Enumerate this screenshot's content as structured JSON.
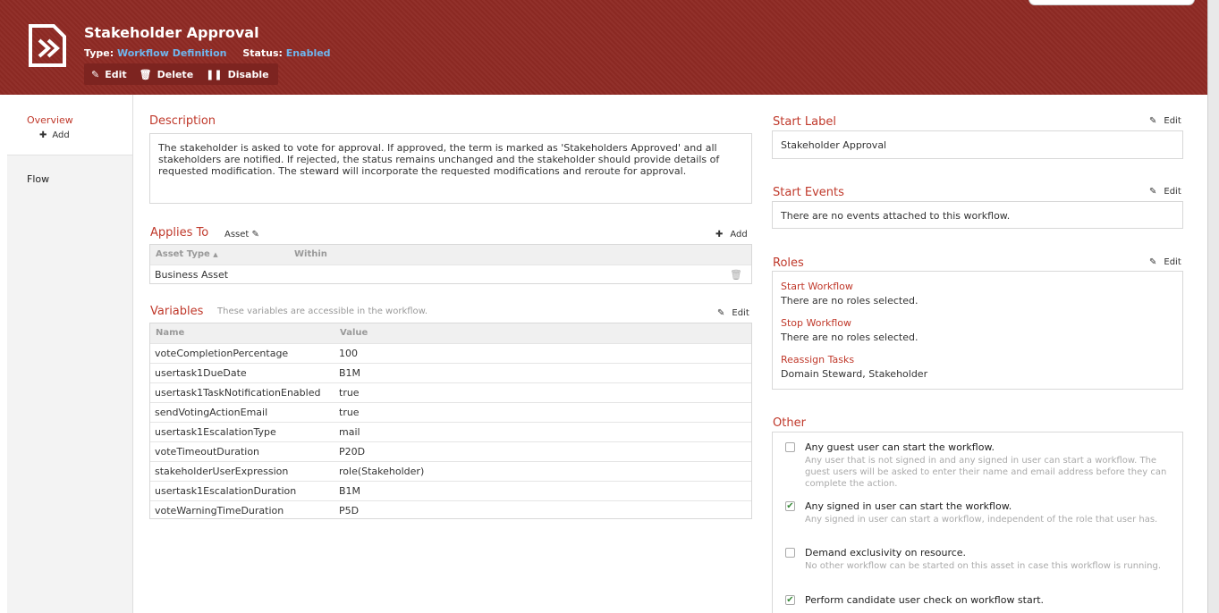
{
  "header": {
    "title": "Stakeholder Approval",
    "type_label": "Type:",
    "type_value": "Workflow Definition",
    "status_label": "Status:",
    "status_value": "Enabled",
    "actions": {
      "edit": "Edit",
      "delete": "Delete",
      "disable": "Disable"
    }
  },
  "sidebar": {
    "overview": "Overview",
    "add": "Add",
    "flow": "Flow"
  },
  "description": {
    "heading": "Description",
    "text": "The stakeholder is asked to vote for approval. If approved, the term is marked as 'Stakeholders Approved' and all stakeholders are notified. If rejected, the status remains unchanged and the stakeholder should provide details of requested modification. The steward will incorporate the requested modifications and reroute for approval."
  },
  "applies_to": {
    "heading": "Applies To",
    "asset_label": "Asset",
    "add": "Add",
    "columns": [
      "Asset Type",
      "Within"
    ],
    "rows": [
      [
        "Business Asset",
        ""
      ]
    ]
  },
  "variables": {
    "heading": "Variables",
    "hint": "These variables are accessible in the workflow.",
    "edit": "Edit",
    "columns": [
      "Name",
      "Value"
    ],
    "rows": [
      [
        "voteCompletionPercentage",
        "100"
      ],
      [
        "usertask1DueDate",
        "B1M"
      ],
      [
        "usertask1TaskNotificationEnabled",
        "true"
      ],
      [
        "sendVotingActionEmail",
        "true"
      ],
      [
        "usertask1EscalationType",
        "mail"
      ],
      [
        "voteTimeoutDuration",
        "P20D"
      ],
      [
        "stakeholderUserExpression",
        "role(Stakeholder)"
      ],
      [
        "usertask1EscalationDuration",
        "B1M"
      ],
      [
        "voteWarningTimeDuration",
        "P5D"
      ]
    ]
  },
  "start_label": {
    "heading": "Start Label",
    "edit": "Edit",
    "value": "Stakeholder Approval"
  },
  "start_events": {
    "heading": "Start Events",
    "edit": "Edit",
    "value": "There are no events attached to this workflow."
  },
  "roles": {
    "heading": "Roles",
    "edit": "Edit",
    "items": [
      {
        "title": "Start Workflow",
        "value": "There are no roles selected."
      },
      {
        "title": "Stop Workflow",
        "value": "There are no roles selected."
      },
      {
        "title": "Reassign Tasks",
        "value": "Domain Steward, Stakeholder"
      }
    ]
  },
  "other": {
    "heading": "Other",
    "options": [
      {
        "title": "Any guest user can start the workflow.",
        "desc": "Any user that is not signed in and any signed in user can start a workflow. The guest users will be asked to enter their name and email address before they can complete the action.",
        "checked": false
      },
      {
        "title": "Any signed in user can start the workflow.",
        "desc": "Any signed in user can start a workflow, independent of the role that user has.",
        "checked": true
      },
      {
        "title": "Demand exclusivity on resource.",
        "desc": "No other workflow can be started on this asset in case this workflow is running.",
        "checked": false
      },
      {
        "title": "Perform candidate user check on workflow start.",
        "desc": "",
        "checked": true
      }
    ]
  },
  "colors": {
    "header": "#8f2a24",
    "accent": "#c0392b",
    "link": "#6fb6ee",
    "check": "#3a8a3a"
  }
}
